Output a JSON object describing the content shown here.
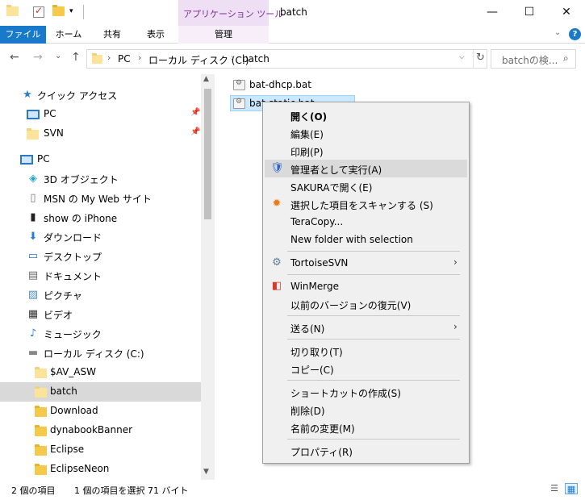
{
  "window": {
    "title": "batch",
    "contextual_tab_header": "アプリケーション ツール",
    "minimize_glyph": "—",
    "maximize_glyph": "☐",
    "close_glyph": "✕"
  },
  "ribbon": {
    "tabs": [
      {
        "label": "ファイル"
      },
      {
        "label": "ホーム"
      },
      {
        "label": "共有"
      },
      {
        "label": "表示"
      },
      {
        "label": "管理"
      }
    ],
    "expand_glyph": "⌄",
    "help_glyph": "?"
  },
  "address": {
    "breadcrumbs": [
      "PC",
      "ローカル ディスク (C:)",
      "batch"
    ],
    "separator": "›",
    "dropdown_glyph": "⌵",
    "refresh_glyph": "↻"
  },
  "nav_buttons": {
    "back": "←",
    "forward": "→",
    "recent": "⌄",
    "up": "↑"
  },
  "search": {
    "placeholder": "batchの検...",
    "icon": "⌕"
  },
  "nav_pane": {
    "items": [
      {
        "label": "クイック アクセス",
        "icon": "star-icon",
        "glyph": "★"
      },
      {
        "label": "PC",
        "icon": "monitor-icon",
        "pinned": true
      },
      {
        "label": "SVN",
        "icon": "folder-icon",
        "pinned": true
      },
      {
        "label": "PC",
        "icon": "monitor-icon"
      },
      {
        "label": "3D オブジェクト",
        "icon": "cube-icon",
        "glyph": "◈"
      },
      {
        "label": "MSN の My Web サイト",
        "icon": "document-icon",
        "glyph": "▯"
      },
      {
        "label": "show の iPhone",
        "icon": "phone-icon",
        "glyph": "▮"
      },
      {
        "label": "ダウンロード",
        "icon": "download-icon",
        "glyph": "⬇"
      },
      {
        "label": "デスクトップ",
        "icon": "desktop-icon",
        "glyph": "▭"
      },
      {
        "label": "ドキュメント",
        "icon": "documents-icon",
        "glyph": "▤"
      },
      {
        "label": "ピクチャ",
        "icon": "pictures-icon",
        "glyph": "▨"
      },
      {
        "label": "ビデオ",
        "icon": "video-icon",
        "glyph": "▦"
      },
      {
        "label": "ミュージック",
        "icon": "music-icon",
        "glyph": "♪"
      },
      {
        "label": "ローカル ディスク (C:)",
        "icon": "drive-icon",
        "glyph": "▬"
      },
      {
        "label": "$AV_ASW",
        "icon": "folder-icon"
      },
      {
        "label": "batch",
        "icon": "folder-icon",
        "selected": true
      },
      {
        "label": "Download",
        "icon": "folder-icon"
      },
      {
        "label": "dynabookBanner",
        "icon": "folder-icon"
      },
      {
        "label": "Eclipse",
        "icon": "folder-icon"
      },
      {
        "label": "EclipseNeon",
        "icon": "folder-icon"
      }
    ],
    "pin_glyph": "📌"
  },
  "files": [
    {
      "name": "bat-dhcp.bat",
      "selected": false
    },
    {
      "name": "bat-static.bat",
      "selected": true
    }
  ],
  "context_menu": {
    "items": [
      {
        "label": "開く(O)",
        "bold": true
      },
      {
        "label": "編集(E)"
      },
      {
        "label": "印刷(P)"
      },
      {
        "label": "管理者として実行(A)",
        "icon": "uac-shield-icon",
        "glyph": "🛡",
        "highlighted": true
      },
      {
        "label": "SAKURAで開く(E)"
      },
      {
        "label": "選択した項目をスキャンする (S)",
        "icon": "avast-icon",
        "glyph": "✹"
      },
      {
        "label": "TeraCopy..."
      },
      {
        "label": "New folder with selection"
      },
      {
        "label": "TortoiseSVN",
        "icon": "tortoisesvn-icon",
        "glyph": "⚙",
        "submenu": true
      },
      {
        "label": "WinMerge",
        "icon": "winmerge-icon",
        "glyph": "◧"
      },
      {
        "label": "以前のバージョンの復元(V)"
      },
      {
        "label": "送る(N)",
        "submenu": true
      },
      {
        "label": "切り取り(T)"
      },
      {
        "label": "コピー(C)"
      },
      {
        "label": "ショートカットの作成(S)"
      },
      {
        "label": "削除(D)"
      },
      {
        "label": "名前の変更(M)"
      },
      {
        "label": "プロパティ(R)"
      }
    ],
    "submenu_glyph": "›"
  },
  "statusbar": {
    "item_count": "2 個の項目",
    "selection": "1 個の項目を選択  71 バイト",
    "details_view_glyph": "☰",
    "tiles_view_glyph": "▦"
  },
  "colors": {
    "accent": "#1979ca",
    "context_tab": "#efdff5",
    "selection": "#cce8ff",
    "menu_background": "#f0f0f0"
  }
}
